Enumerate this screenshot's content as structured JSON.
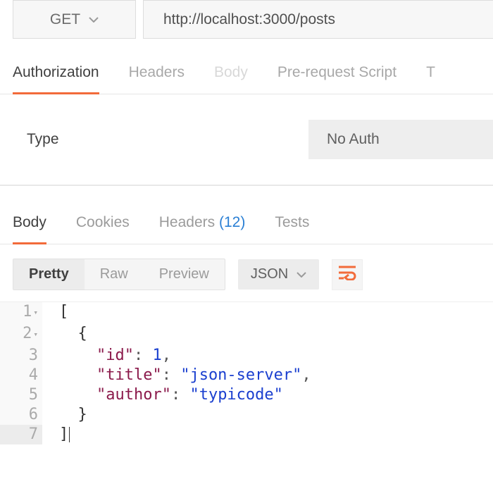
{
  "request": {
    "method": "GET",
    "url": "http://localhost:3000/posts"
  },
  "request_tabs": {
    "authorization": "Authorization",
    "headers": "Headers",
    "body": "Body",
    "prerequest": "Pre-request Script",
    "tests_partial": "T"
  },
  "auth": {
    "label": "Type",
    "selected": "No Auth"
  },
  "response_tabs": {
    "body": "Body",
    "cookies": "Cookies",
    "headers_label": "Headers",
    "headers_count": "(12)",
    "tests": "Tests"
  },
  "view": {
    "pretty": "Pretty",
    "raw": "Raw",
    "preview": "Preview"
  },
  "format": {
    "selected": "JSON"
  },
  "code": {
    "line1": "[",
    "line2_indent": "  ",
    "line2": "{",
    "line3_indent": "    ",
    "line3_key": "\"id\"",
    "line3_sep": ": ",
    "line3_val": "1",
    "line3_end": ",",
    "line4_indent": "    ",
    "line4_key": "\"title\"",
    "line4_sep": ": ",
    "line4_val": "\"json-server\"",
    "line4_end": ",",
    "line5_indent": "    ",
    "line5_key": "\"author\"",
    "line5_sep": ": ",
    "line5_val": "\"typicode\"",
    "line6_indent": "  ",
    "line6": "}",
    "line7": "]"
  },
  "linenums": {
    "l1": "1",
    "l2": "2",
    "l3": "3",
    "l4": "4",
    "l5": "5",
    "l6": "6",
    "l7": "7"
  }
}
